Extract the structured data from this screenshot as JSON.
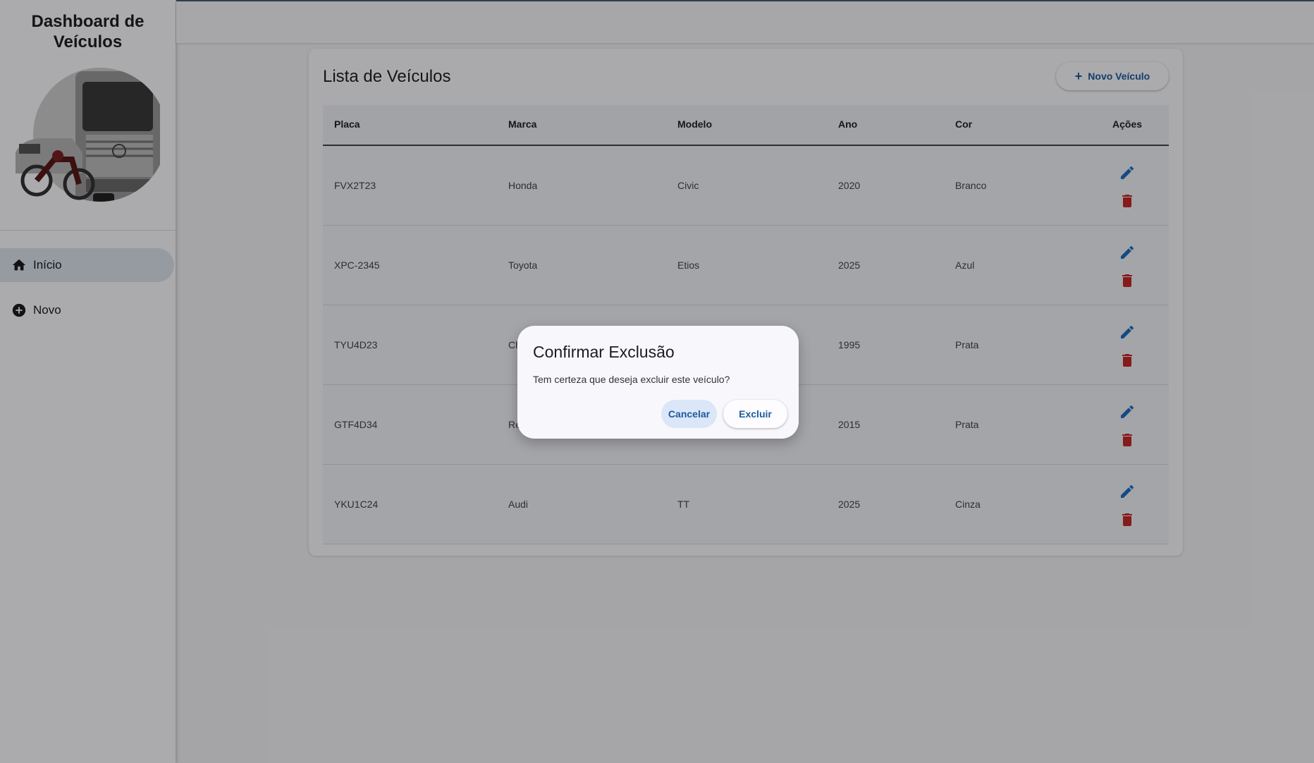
{
  "sidebar": {
    "title_line1": "Dashboard de",
    "title_line2": "Veículos",
    "image_alt": "Veículos",
    "items": [
      {
        "label": "Início",
        "icon": "home-icon"
      },
      {
        "label": "Novo",
        "icon": "add-circle-icon"
      }
    ]
  },
  "main": {
    "title": "Lista de Veículos",
    "new_button_label": "Novo Veículo",
    "columns": [
      "Placa",
      "Marca",
      "Modelo",
      "Ano",
      "Cor",
      "Ações"
    ],
    "rows": [
      [
        "FVX2T23",
        "Honda",
        "Civic",
        "2020",
        "Branco"
      ],
      [
        "XPC-2345",
        "Toyota",
        "Etios",
        "2025",
        "Azul"
      ],
      [
        "TYU4D23",
        "Ch",
        "",
        "1995",
        "Prata"
      ],
      [
        "GTF4D34",
        "Re",
        "",
        "2015",
        "Prata"
      ],
      [
        "YKU1C24",
        "Audi",
        "TT",
        "2025",
        "Cinza"
      ]
    ]
  },
  "dialog": {
    "title": "Confirmar Exclusão",
    "message": "Tem certeza que deseja excluir este veículo?",
    "cancel_label": "Cancelar",
    "confirm_label": "Excluir"
  },
  "colors": {
    "accent": "#1e5aa0",
    "edit_icon": "#1e6fc0",
    "delete_icon": "#c62828"
  }
}
